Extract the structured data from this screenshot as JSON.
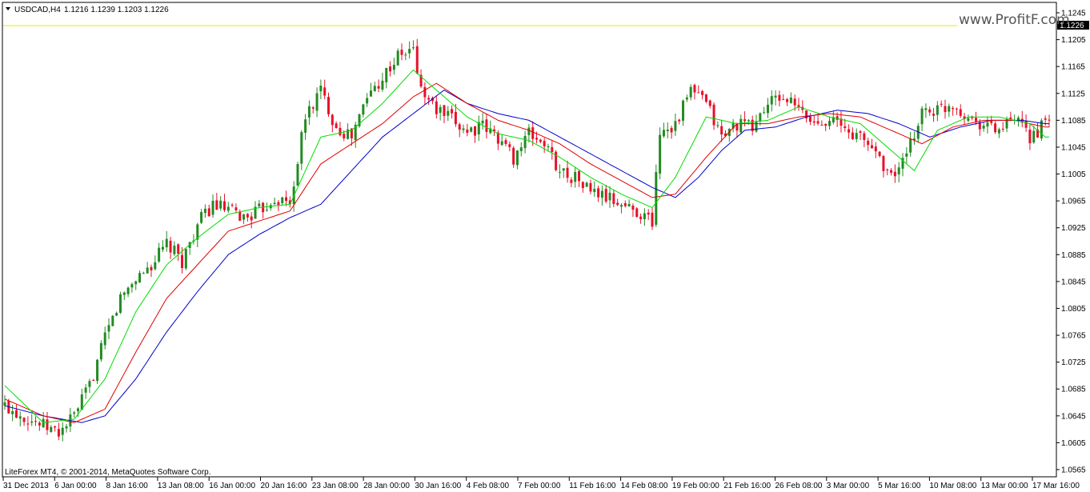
{
  "header": {
    "symbol": "USDCAD,H4",
    "ohlc": "1.1216 1.1239 1.1203 1.1226"
  },
  "footer": {
    "copyright": "LiteForex MT4, © 2001-2014, MetaQuotes Software Corp."
  },
  "watermark": "www.ProfitF.com",
  "colors": {
    "bull": "#228b22",
    "bear": "#e8102a",
    "ma_fast": "#00dd00",
    "ma_mid": "#e00000",
    "ma_slow": "#0000cc",
    "price_line": "#e8e800",
    "price_tag_bg": "#000000"
  },
  "chart_data": {
    "type": "candlestick",
    "y_ticks": [
      "1.1245",
      "1.1205",
      "1.1165",
      "1.1125",
      "1.1085",
      "1.1045",
      "1.1005",
      "1.0965",
      "1.0925",
      "1.0885",
      "1.0845",
      "1.0805",
      "1.0765",
      "1.0725",
      "1.0685",
      "1.0645",
      "1.0605",
      "1.0565"
    ],
    "ylim": [
      1.0565,
      1.1245
    ],
    "current_price": "1.1226",
    "x_ticks": [
      "31 Dec 2013",
      "6 Jan 00:00",
      "8 Jan 16:00",
      "13 Jan 08:00",
      "16 Jan 00:00",
      "20 Jan 16:00",
      "23 Jan 08:00",
      "28 Jan 00:00",
      "30 Jan 16:00",
      "4 Feb 08:00",
      "7 Feb 00:00",
      "11 Feb 16:00",
      "14 Feb 08:00",
      "19 Feb 00:00",
      "21 Feb 16:00",
      "26 Feb 08:00",
      "3 Mar 00:00",
      "5 Mar 16:00",
      "10 Mar 08:00",
      "13 Mar 00:00",
      "17 Mar 16:00"
    ],
    "close_anchors": [
      [
        0,
        1.066
      ],
      [
        5,
        1.0645
      ],
      [
        10,
        1.063
      ],
      [
        14,
        1.062
      ],
      [
        18,
        1.0645
      ],
      [
        22,
        1.069
      ],
      [
        26,
        1.076
      ],
      [
        30,
        1.082
      ],
      [
        34,
        1.085
      ],
      [
        38,
        1.087
      ],
      [
        42,
        1.09
      ],
      [
        46,
        1.0875
      ],
      [
        50,
        1.093
      ],
      [
        54,
        1.096
      ],
      [
        58,
        1.095
      ],
      [
        62,
        1.094
      ],
      [
        66,
        1.095
      ],
      [
        70,
        1.097
      ],
      [
        74,
        1.096
      ],
      [
        78,
        1.109
      ],
      [
        82,
        1.113
      ],
      [
        86,
        1.1075
      ],
      [
        90,
        1.106
      ],
      [
        94,
        1.112
      ],
      [
        98,
        1.115
      ],
      [
        102,
        1.118
      ],
      [
        106,
        1.119
      ],
      [
        108,
        1.113
      ],
      [
        112,
        1.11
      ],
      [
        116,
        1.1085
      ],
      [
        120,
        1.107
      ],
      [
        124,
        1.1075
      ],
      [
        128,
        1.106
      ],
      [
        132,
        1.103
      ],
      [
        136,
        1.1065
      ],
      [
        140,
        1.105
      ],
      [
        144,
        1.101
      ],
      [
        148,
        1.1
      ],
      [
        152,
        1.098
      ],
      [
        156,
        1.097
      ],
      [
        160,
        1.096
      ],
      [
        164,
        1.095
      ],
      [
        168,
        1.0935
      ],
      [
        170,
        1.107
      ],
      [
        174,
        1.108
      ],
      [
        178,
        1.113
      ],
      [
        182,
        1.111
      ],
      [
        186,
        1.106
      ],
      [
        190,
        1.108
      ],
      [
        194,
        1.1075
      ],
      [
        198,
        1.111
      ],
      [
        202,
        1.112
      ],
      [
        206,
        1.11
      ],
      [
        210,
        1.108
      ],
      [
        214,
        1.109
      ],
      [
        218,
        1.107
      ],
      [
        222,
        1.106
      ],
      [
        226,
        1.104
      ],
      [
        230,
        1.1
      ],
      [
        234,
        1.103
      ],
      [
        238,
        1.11
      ],
      [
        242,
        1.11
      ],
      [
        246,
        1.111
      ],
      [
        250,
        1.109
      ],
      [
        254,
        1.108
      ],
      [
        258,
        1.107
      ],
      [
        262,
        1.1085
      ],
      [
        266,
        1.106
      ],
      [
        270,
        1.108
      ]
    ],
    "ma_fast_anchors": [
      [
        0,
        1.069
      ],
      [
        10,
        1.0635
      ],
      [
        18,
        1.064
      ],
      [
        26,
        1.07
      ],
      [
        34,
        1.08
      ],
      [
        42,
        1.087
      ],
      [
        50,
        1.091
      ],
      [
        58,
        1.0945
      ],
      [
        66,
        1.0955
      ],
      [
        74,
        1.096
      ],
      [
        82,
        1.106
      ],
      [
        90,
        1.107
      ],
      [
        98,
        1.111
      ],
      [
        106,
        1.116
      ],
      [
        112,
        1.113
      ],
      [
        120,
        1.109
      ],
      [
        128,
        1.1065
      ],
      [
        136,
        1.1055
      ],
      [
        144,
        1.103
      ],
      [
        152,
        1.1
      ],
      [
        160,
        1.0975
      ],
      [
        168,
        1.0955
      ],
      [
        174,
        1.1
      ],
      [
        182,
        1.109
      ],
      [
        190,
        1.108
      ],
      [
        198,
        1.1085
      ],
      [
        206,
        1.1105
      ],
      [
        214,
        1.109
      ],
      [
        222,
        1.108
      ],
      [
        230,
        1.104
      ],
      [
        236,
        1.101
      ],
      [
        242,
        1.107
      ],
      [
        250,
        1.109
      ],
      [
        258,
        1.109
      ],
      [
        266,
        1.108
      ],
      [
        270,
        1.106
      ]
    ],
    "ma_mid_anchors": [
      [
        0,
        1.067
      ],
      [
        10,
        1.0645
      ],
      [
        18,
        1.0635
      ],
      [
        26,
        1.0655
      ],
      [
        34,
        1.074
      ],
      [
        42,
        1.082
      ],
      [
        50,
        1.087
      ],
      [
        58,
        1.092
      ],
      [
        66,
        1.0935
      ],
      [
        74,
        1.095
      ],
      [
        82,
        1.102
      ],
      [
        90,
        1.105
      ],
      [
        98,
        1.108
      ],
      [
        106,
        1.112
      ],
      [
        112,
        1.114
      ],
      [
        120,
        1.111
      ],
      [
        128,
        1.1085
      ],
      [
        136,
        1.107
      ],
      [
        144,
        1.105
      ],
      [
        152,
        1.102
      ],
      [
        160,
        1.0995
      ],
      [
        168,
        1.097
      ],
      [
        174,
        1.0975
      ],
      [
        182,
        1.103
      ],
      [
        190,
        1.108
      ],
      [
        198,
        1.108
      ],
      [
        206,
        1.109
      ],
      [
        214,
        1.1095
      ],
      [
        222,
        1.109
      ],
      [
        230,
        1.107
      ],
      [
        238,
        1.105
      ],
      [
        246,
        1.1075
      ],
      [
        254,
        1.1085
      ],
      [
        262,
        1.1085
      ],
      [
        270,
        1.1075
      ]
    ],
    "ma_slow_anchors": [
      [
        0,
        1.066
      ],
      [
        10,
        1.0645
      ],
      [
        20,
        1.0635
      ],
      [
        26,
        1.0645
      ],
      [
        34,
        1.07
      ],
      [
        42,
        1.077
      ],
      [
        50,
        1.083
      ],
      [
        58,
        1.0885
      ],
      [
        66,
        1.0915
      ],
      [
        74,
        1.094
      ],
      [
        82,
        1.096
      ],
      [
        90,
        1.101
      ],
      [
        98,
        1.106
      ],
      [
        106,
        1.1095
      ],
      [
        114,
        1.113
      ],
      [
        120,
        1.111
      ],
      [
        128,
        1.1095
      ],
      [
        136,
        1.1085
      ],
      [
        144,
        1.106
      ],
      [
        152,
        1.1035
      ],
      [
        160,
        1.101
      ],
      [
        168,
        1.0985
      ],
      [
        174,
        1.097
      ],
      [
        180,
        1.1
      ],
      [
        186,
        1.104
      ],
      [
        192,
        1.107
      ],
      [
        200,
        1.1075
      ],
      [
        208,
        1.109
      ],
      [
        216,
        1.11
      ],
      [
        224,
        1.1095
      ],
      [
        232,
        1.108
      ],
      [
        240,
        1.106
      ],
      [
        248,
        1.1075
      ],
      [
        256,
        1.1085
      ],
      [
        264,
        1.1085
      ],
      [
        270,
        1.108
      ]
    ]
  }
}
